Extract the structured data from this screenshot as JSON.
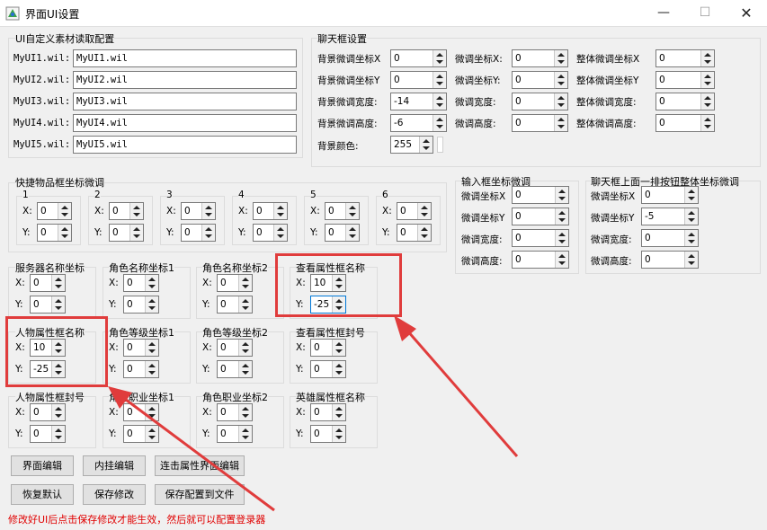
{
  "window": {
    "title": "界面UI设置",
    "minimize": "—",
    "maximize": "☐",
    "close": "✕"
  },
  "ui_group": {
    "title": "UI自定义素材读取配置",
    "rows": [
      {
        "label": "MyUI1.wil:",
        "value": "MyUI1.wil"
      },
      {
        "label": "MyUI2.wil:",
        "value": "MyUI2.wil"
      },
      {
        "label": "MyUI3.wil:",
        "value": "MyUI3.wil"
      },
      {
        "label": "MyUI4.wil:",
        "value": "MyUI4.wil"
      },
      {
        "label": "MyUI5.wil:",
        "value": "MyUI5.wil"
      }
    ]
  },
  "chat_group": {
    "title": "聊天框设置",
    "rows": [
      {
        "bg_label": "背景微调坐标X",
        "bg_value": "0",
        "fine_label": "微调坐标X:",
        "fine_value": "0",
        "whole_label": "整体微调坐标X",
        "whole_value": "0"
      },
      {
        "bg_label": "背景微调坐标Y",
        "bg_value": "0",
        "fine_label": "微调坐标Y:",
        "fine_value": "0",
        "whole_label": "整体微调坐标Y",
        "whole_value": "0"
      },
      {
        "bg_label": "背景微调宽度:",
        "bg_value": "-14",
        "fine_label": "微调宽度:",
        "fine_value": "0",
        "whole_label": "整体微调宽度:",
        "whole_value": "0"
      },
      {
        "bg_label": "背景微调高度:",
        "bg_value": "-6",
        "fine_label": "微调高度:",
        "fine_value": "0",
        "whole_label": "整体微调高度:",
        "whole_value": "0"
      }
    ],
    "bg_color_label": "背景颜色:",
    "bg_color_value": "255"
  },
  "quick_group": {
    "title": "快捷物品框坐标微调",
    "slots": [
      {
        "num": "1",
        "x": "0",
        "y": "0"
      },
      {
        "num": "2",
        "x": "0",
        "y": "0"
      },
      {
        "num": "3",
        "x": "0",
        "y": "0"
      },
      {
        "num": "4",
        "x": "0",
        "y": "0"
      },
      {
        "num": "5",
        "x": "0",
        "y": "0"
      },
      {
        "num": "6",
        "x": "0",
        "y": "0"
      }
    ],
    "x_label": "X:",
    "y_label": "Y:"
  },
  "input_group": {
    "title": "输入框坐标微调",
    "rows": [
      {
        "label": "微调坐标X",
        "value": "0"
      },
      {
        "label": "微调坐标Y",
        "value": "0"
      },
      {
        "label": "微调宽度:",
        "value": "0"
      },
      {
        "label": "微调高度:",
        "value": "0"
      }
    ]
  },
  "chatbtn_group": {
    "title": "聊天框上面一排按钮整体坐标微调",
    "rows": [
      {
        "label": "微调坐标X",
        "value": "0"
      },
      {
        "label": "微调坐标Y",
        "value": "-5"
      },
      {
        "label": "微调宽度:",
        "value": "0"
      },
      {
        "label": "微调高度:",
        "value": "0"
      }
    ]
  },
  "coord_groups": [
    {
      "title": "服务器名称坐标",
      "x": "0",
      "y": "0"
    },
    {
      "title": "角色名称坐标1",
      "x": "0",
      "y": "0"
    },
    {
      "title": "角色名称坐标2",
      "x": "0",
      "y": "0"
    },
    {
      "title": "查看属性框名称",
      "x": "10",
      "y": "-25"
    },
    {
      "title": "人物属性框名称",
      "x": "10",
      "y": "-25"
    },
    {
      "title": "角色等级坐标1",
      "x": "0",
      "y": "0"
    },
    {
      "title": "角色等级坐标2",
      "x": "0",
      "y": "0"
    },
    {
      "title": "查看属性框封号",
      "x": "0",
      "y": "0"
    },
    {
      "title": "人物属性框封号",
      "x": "0",
      "y": "0"
    },
    {
      "title": "角色职业坐标1",
      "x": "0",
      "y": "0"
    },
    {
      "title": "角色职业坐标2",
      "x": "0",
      "y": "0"
    },
    {
      "title": "英雄属性框名称",
      "x": "0",
      "y": "0"
    }
  ],
  "buttons": {
    "ui_edit": "界面编辑",
    "plugin_edit": "内挂编辑",
    "hit_attr_edit": "连击属性界面编辑",
    "restore_default": "恢复默认",
    "save_changes": "保存修改",
    "save_config_file": "保存配置到文件"
  },
  "footer_note": "修改好UI后点击保存修改才能生效，然后就可以配置登录器",
  "colors": {
    "highlight": "#e03c3c",
    "footer_text": "#e00000"
  }
}
